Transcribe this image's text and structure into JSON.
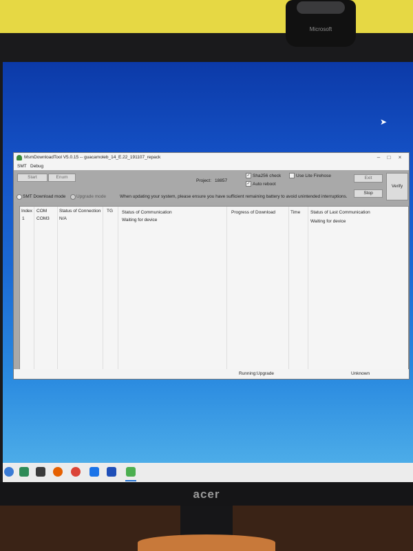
{
  "physical": {
    "webcam_brand": "Microsoft",
    "monitor_brand": "acer"
  },
  "window": {
    "title": "MsmDownloadTool V5.0.15 -- guacamoleb_14_E.22_191107_repack",
    "controls": {
      "minimize": "–",
      "maximize": "□",
      "close": "×"
    }
  },
  "menu": [
    "SMT",
    "Debug"
  ],
  "toolbar": {
    "start_label": "Start",
    "enum_label": "Enum",
    "project_label": "Project:",
    "project_value": "18857",
    "sha256_label": "Sha256 check",
    "sha256_checked": true,
    "auto_reboot_label": "Auto reboot",
    "auto_reboot_checked": true,
    "lite_firehose_label": "Use Lite Firehose",
    "lite_firehose_checked": false,
    "exit_label": "Exit",
    "stop_label": "Stop",
    "verify_label": "Verify",
    "smt_mode_label": "SMT Download mode",
    "upgrade_mode_label": "Upgrade mode",
    "warning": "When updating your system, please ensure you have sufficient remaining battery to avoid unintended interruptions."
  },
  "table": {
    "headers": [
      "Index",
      "COM",
      "Status of Connection",
      "TG",
      "Status of Communication",
      "Progress of Download",
      "Time",
      "Status of Last Communication"
    ],
    "rows": [
      {
        "index": "1",
        "com": "COM3",
        "connection": "N/A",
        "tg": "",
        "communication": "Waiting for device",
        "progress": "",
        "time": "",
        "last_communication": "Waiting for device"
      }
    ]
  },
  "status": {
    "mode": "Running:Upgrade",
    "state": "Unknown"
  },
  "taskbar": {
    "icons": [
      "windows-start-icon",
      "file-explorer-icon",
      "mail-icon",
      "firefox-icon",
      "chrome-icon",
      "app-icon",
      "save-icon",
      "download-tool-icon"
    ]
  },
  "colors": {
    "desktop_top": "#0c3aa8",
    "desktop_bottom": "#54b4ea",
    "window_body": "#a8a8a8",
    "table_bg": "#f5f5f5"
  }
}
